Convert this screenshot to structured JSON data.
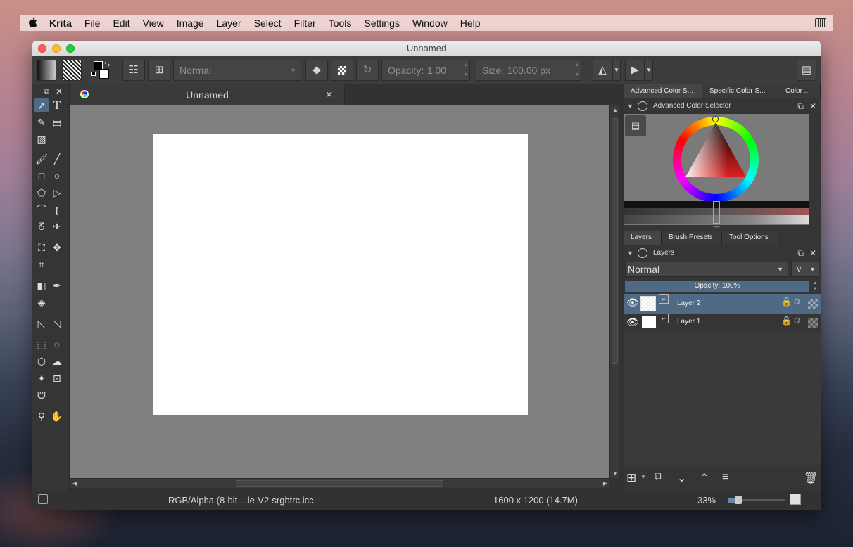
{
  "menubar": {
    "apple": "",
    "app": "Krita",
    "items": [
      "File",
      "Edit",
      "View",
      "Image",
      "Layer",
      "Select",
      "Filter",
      "Tools",
      "Settings",
      "Window",
      "Help"
    ]
  },
  "window": {
    "title": "Unnamed"
  },
  "toolbar": {
    "blend_mode": "Normal",
    "opacity_label": "Opacity:",
    "opacity_value": "1.00",
    "size_label": "Size:",
    "size_value": "100.00 px"
  },
  "document": {
    "tab_title": "Unnamed"
  },
  "status": {
    "color_profile": "RGB/Alpha (8-bit ...le-V2-srgbtrc.icc",
    "dimensions": "1600 x 1200 (14.7M)",
    "zoom": "33%"
  },
  "color_docker": {
    "tabs": [
      "Advanced Color S...",
      "Specific Color S...",
      "Color ..."
    ],
    "title": "Advanced Color Selector"
  },
  "layers_docker": {
    "tabs": [
      "Layers",
      "Brush Presets",
      "Tool Options"
    ],
    "title": "Layers",
    "blend_mode": "Normal",
    "opacity": "Opacity:  100%",
    "layers": [
      {
        "name": "Layer 2",
        "selected": true
      },
      {
        "name": "Layer 1",
        "selected": false
      }
    ]
  },
  "colors": {
    "selection": "#4e6a85",
    "panel": "#353535",
    "canvas_bg": "#808080"
  }
}
